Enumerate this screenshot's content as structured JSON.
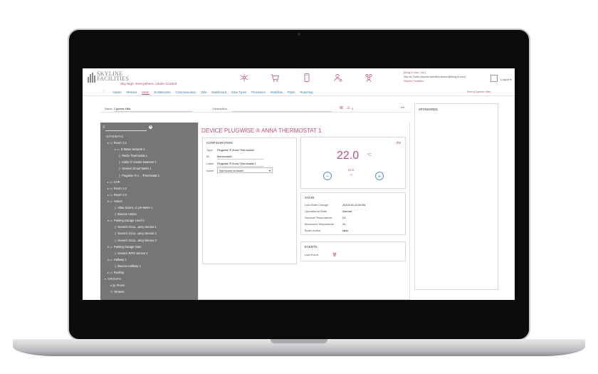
{
  "app": {
    "logo_line1": "SKYLINE",
    "logo_line2": "FACILITIES",
    "tagline": "Sky-high. Everywhere. Under Control."
  },
  "header": {
    "icons": [
      "network-icon",
      "cart-icon",
      "device-icon",
      "user-settings-icon",
      "users-icon"
    ],
    "user_line1": "[thing-it User: 4d1]",
    "user_line2": "Sky du Troits (skyline-facilities-admin@thing-it.com)",
    "user_line3": "Skyline Facilities",
    "logout_label": "Logout"
  },
  "nav": {
    "items": [
      {
        "label": "Assets",
        "active": false
      },
      {
        "label": "Meshes",
        "active": false
      },
      {
        "label": "Mesh",
        "active": true
      },
      {
        "label": "Entitlements",
        "active": false
      },
      {
        "label": "Communication",
        "active": false
      },
      {
        "label": "Wiki",
        "active": false
      },
      {
        "label": "Dashboard",
        "active": false
      },
      {
        "label": "Data Types",
        "active": false
      },
      {
        "label": "Processes",
        "active": false
      },
      {
        "label": "Workflow",
        "active": false
      },
      {
        "label": "Plans",
        "active": false
      },
      {
        "label": "Reporting",
        "active": false
      }
    ],
    "right_label": "Next (Cypress Hills)"
  },
  "name_bar": {
    "name_label": "Name",
    "name_value": "Cypress Hills",
    "description_label": "Description",
    "count": "6"
  },
  "tree": {
    "rows": [
      {
        "label": "GATEWAYS",
        "indent": 6,
        "glyph": "",
        "section": true
      },
      {
        "label": "Room 1-1",
        "indent": 10,
        "glyph": "▸ ▭",
        "section": false
      },
      {
        "label": "Z-Wave Network 1",
        "indent": 20,
        "glyph": "▸ ▭",
        "section": false
      },
      {
        "label": "Radio Thermostat 1",
        "indent": 26,
        "glyph": "▯",
        "section": false
      },
      {
        "label": "Kidde ® Smoke Detector 1",
        "indent": 26,
        "glyph": "▯",
        "section": false
      },
      {
        "label": "Generic Smart Meter 1",
        "indent": 26,
        "glyph": "▯",
        "section": false
      },
      {
        "label": "Plugwise ® A... Thermostat 1",
        "indent": 26,
        "glyph": "▯",
        "section": false
      },
      {
        "label": "CHP",
        "indent": 10,
        "glyph": "▸ ▭",
        "section": false
      },
      {
        "label": "Room 1-2",
        "indent": 10,
        "glyph": "▸ ▭",
        "section": false
      },
      {
        "label": "Room 1-3",
        "indent": 10,
        "glyph": "▸ ▭",
        "section": false
      },
      {
        "label": "Atrium",
        "indent": 10,
        "glyph": "▾ ▭",
        "section": false
      },
      {
        "label": "Atlas Scient...ic pH Meter 1",
        "indent": 20,
        "glyph": "▯",
        "section": false
      },
      {
        "label": "Beacon Atrium",
        "indent": 20,
        "glyph": "▯",
        "section": false
      },
      {
        "label": "Parking Garage Level 1",
        "indent": 10,
        "glyph": "▾ ▭",
        "section": false
      },
      {
        "label": "Generic Occu...ancy Sensor 1",
        "indent": 20,
        "glyph": "▯",
        "section": false
      },
      {
        "label": "Generic Occu...ancy Sensor 2",
        "indent": 20,
        "glyph": "▯",
        "section": false
      },
      {
        "label": "Generic Occu...ancy Sensor 3",
        "indent": 20,
        "glyph": "▯",
        "section": false
      },
      {
        "label": "Parking Garage Gate",
        "indent": 10,
        "glyph": "▾ ▭",
        "section": false
      },
      {
        "label": "Generic RFID Sensor 1",
        "indent": 20,
        "glyph": "▯",
        "section": false
      },
      {
        "label": "Hallway 1",
        "indent": 10,
        "glyph": "▾ ▭",
        "section": false
      },
      {
        "label": "Beacon Hallway 1",
        "indent": 20,
        "glyph": "▯",
        "section": false
      },
      {
        "label": "Rooftop",
        "indent": 10,
        "glyph": "▸ ▭",
        "section": false
      },
      {
        "label": "GROUPS",
        "indent": 6,
        "glyph": "▾",
        "section": true
      },
      {
        "label": "Floors",
        "indent": 14,
        "glyph": "▸ ▤",
        "section": false
      },
      {
        "label": "Tenants",
        "indent": 14,
        "glyph": "▽",
        "section": false
      }
    ]
  },
  "device": {
    "title": "DEVICE PLUGWISE ® ANNA THERMOSTAT 1"
  },
  "configuration": {
    "title": "CONFIGURATION",
    "type_label": "Type",
    "type_value": "Plugwise ® Anna Thermostat",
    "id_label": "ID",
    "id_value": "thermostat1",
    "label_label": "Label",
    "label_value": "Plugwise ® Anna Thermostat 1",
    "asset_label": "Asset",
    "asset_value": "Not bound to Asset"
  },
  "thermostat": {
    "temperature": "22.0",
    "unit": "°C",
    "setpoint": "22.0",
    "setpoint_unit": "°C",
    "minus_label": "−",
    "plus_label": "+"
  },
  "state": {
    "title": "STATE",
    "rows": [
      {
        "label": "Last State Change",
        "value": "24/10/16 21:54:54"
      },
      {
        "label": "Operational State",
        "value": "Normal"
      },
      {
        "label": "Nominal Temperature",
        "value": "22"
      },
      {
        "label": "Measured Temperature",
        "value": "22"
      },
      {
        "label": "Boiler Active",
        "value": "false"
      }
    ]
  },
  "events": {
    "title": "EVENTS",
    "last_event_label": "Last Event"
  },
  "sponsored": {
    "title": "SPONSORED"
  },
  "colors": {
    "accent": "#c0506a",
    "link": "#2f7fb5",
    "sidebar": "#767676"
  }
}
